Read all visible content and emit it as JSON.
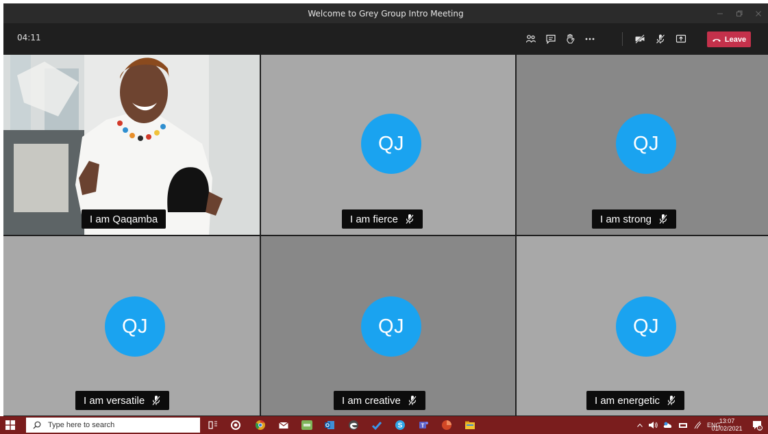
{
  "window": {
    "title": "Welcome to Grey Group Intro Meeting",
    "controls": [
      "minimize",
      "restore",
      "close"
    ]
  },
  "toolbar": {
    "timer": "04:11",
    "buttons": [
      {
        "name": "participants",
        "icon": "people-icon"
      },
      {
        "name": "chat",
        "icon": "chat-icon"
      },
      {
        "name": "raise-hand",
        "icon": "hand-icon"
      },
      {
        "name": "more-actions",
        "icon": "ellipsis-icon"
      },
      {
        "name": "camera-off",
        "icon": "video-off-icon"
      },
      {
        "name": "mic-off",
        "icon": "mic-off-icon"
      },
      {
        "name": "share-screen",
        "icon": "share-screen-icon"
      }
    ],
    "leave_label": "Leave",
    "leave_color": "#c4314b"
  },
  "participants": [
    {
      "label": "I am Qaqamba",
      "video": true,
      "muted": false
    },
    {
      "label": "I am fierce",
      "initials": "QJ",
      "muted": true
    },
    {
      "label": "I am strong",
      "initials": "QJ",
      "muted": true
    },
    {
      "label": "I am versatile",
      "initials": "QJ",
      "muted": true
    },
    {
      "label": "I am creative",
      "initials": "QJ",
      "muted": true
    },
    {
      "label": "I am energetic",
      "initials": "QJ",
      "muted": true
    }
  ],
  "colors": {
    "avatar": "#1aa3f0",
    "tile_light": "#a8a8a8",
    "tile_dark": "#888888",
    "taskbar": "#7a1d1d"
  },
  "taskbar": {
    "search_placeholder": "Type here to search",
    "pinned_apps": [
      "task-view",
      "whatsapp",
      "chrome",
      "mail",
      "sage",
      "outlook",
      "edge",
      "todo",
      "skype",
      "teams",
      "powerpoint",
      "file-explorer"
    ],
    "tray_language": "ENG",
    "time": "13:07",
    "date": "01/02/2021"
  }
}
